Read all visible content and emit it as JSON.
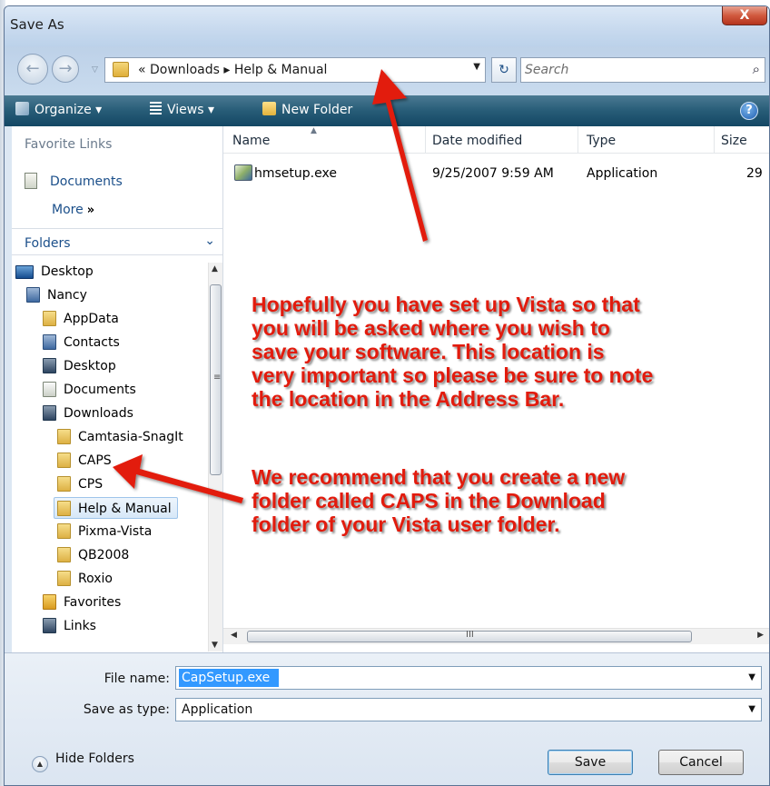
{
  "window": {
    "title": "Save As",
    "close_glyph": "X"
  },
  "address": {
    "path": "« Downloads ▸ Help & Manual",
    "search_placeholder": "Search"
  },
  "toolbar": {
    "organize": "Organize ▾",
    "views": "Views ▾",
    "new_folder": "New Folder",
    "help": "?"
  },
  "favorites": {
    "header": "Favorite Links",
    "documents": "Documents",
    "more": "More",
    "more_glyph": "»"
  },
  "folders": {
    "header": "Folders",
    "items": [
      {
        "label": "Desktop",
        "icon": "desktop-icon"
      },
      {
        "label": "Nancy",
        "icon": "user-folder-icon"
      },
      {
        "label": "AppData",
        "icon": "folder-icon"
      },
      {
        "label": "Contacts",
        "icon": "contacts-icon"
      },
      {
        "label": "Desktop",
        "icon": "desktop-folder-icon"
      },
      {
        "label": "Documents",
        "icon": "documents-icon"
      },
      {
        "label": "Downloads",
        "icon": "downloads-icon"
      },
      {
        "label": "Camtasia-SnagIt",
        "icon": "folder-icon"
      },
      {
        "label": "CAPS",
        "icon": "folder-icon"
      },
      {
        "label": "CPS",
        "icon": "folder-icon"
      },
      {
        "label": "Help & Manual",
        "icon": "folder-icon",
        "selected": true
      },
      {
        "label": "Pixma-Vista",
        "icon": "folder-icon"
      },
      {
        "label": "QB2008",
        "icon": "folder-icon"
      },
      {
        "label": "Roxio",
        "icon": "folder-icon"
      },
      {
        "label": "Favorites",
        "icon": "favorites-icon"
      },
      {
        "label": "Links",
        "icon": "links-icon"
      }
    ]
  },
  "file_list": {
    "columns": [
      "Name",
      "Date modified",
      "Type",
      "Size"
    ],
    "rows": [
      {
        "name": "hmsetup.exe",
        "date": "9/25/2007 9:59 AM",
        "type": "Application",
        "size": "29"
      }
    ],
    "h_scroll_grip": "III"
  },
  "bottom": {
    "file_name_label": "File name:",
    "file_name_value": "CapSetup.exe",
    "save_type_label": "Save as type:",
    "save_type_value": "Application",
    "hide_folders": "Hide Folders",
    "save_button": "Save",
    "cancel_button": "Cancel"
  },
  "annotations": {
    "note1": [
      "Hopefully you have set up Vista so that",
      "you will be asked where you wish to",
      "save your software.  This location is",
      "very important so please be sure to note",
      "the location in the Address Bar."
    ],
    "note2": [
      "We recommend that you create a new",
      "folder called CAPS in the Download",
      "folder of your Vista user folder."
    ],
    "color": "#e21b0d"
  }
}
